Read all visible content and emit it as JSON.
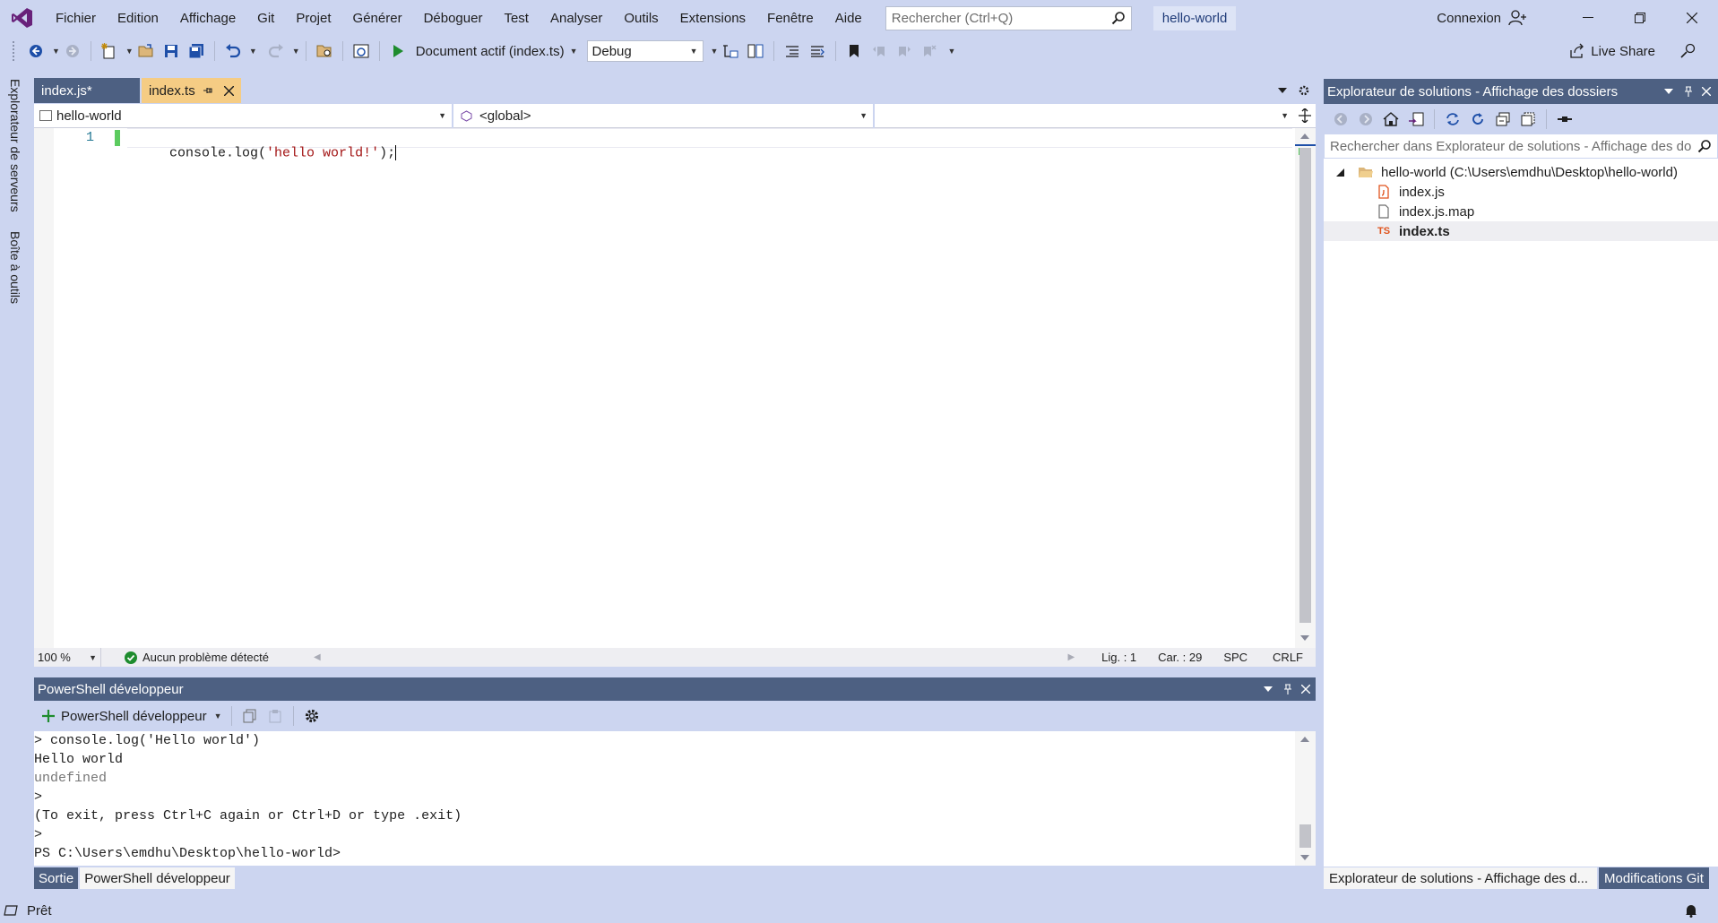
{
  "titlebar": {
    "menu": [
      "Fichier",
      "Edition",
      "Affichage",
      "Git",
      "Projet",
      "Générer",
      "Déboguer",
      "Test",
      "Analyser",
      "Outils",
      "Extensions",
      "Fenêtre",
      "Aide"
    ],
    "search_placeholder": "Rechercher (Ctrl+Q)",
    "solution_name": "hello-world",
    "signin": "Connexion"
  },
  "toolbar": {
    "run_label": "Document actif (index.ts)",
    "config": "Debug",
    "live_share": "Live Share"
  },
  "left_rail": {
    "server_explorer": "Explorateur de serveurs",
    "toolbox": "Boîte à outils"
  },
  "editor": {
    "tabs": [
      {
        "label": "index.js*",
        "active": false
      },
      {
        "label": "index.ts",
        "active": true
      }
    ],
    "nav_project": "hello-world",
    "nav_scope": "<global>",
    "line_number": "1",
    "code_prefix": "console.log(",
    "code_string": "'hello world!'",
    "code_suffix": ");",
    "status": {
      "zoom": "100 %",
      "problems": "Aucun problème détecté",
      "line": "Lig. : 1",
      "col": "Car. : 29",
      "indent": "SPC",
      "eol": "CRLF"
    }
  },
  "terminal": {
    "title": "PowerShell développeur",
    "new_terminal_label": "PowerShell développeur",
    "lines": [
      {
        "text": "> console.log('Hello world')",
        "dim": false
      },
      {
        "text": "Hello world",
        "dim": false
      },
      {
        "text": "undefined",
        "dim": true
      },
      {
        "text": ">",
        "dim": false
      },
      {
        "text": "(To exit, press Ctrl+C again or Ctrl+D or type .exit)",
        "dim": false
      },
      {
        "text": ">",
        "dim": false
      },
      {
        "text": "PS C:\\Users\\emdhu\\Desktop\\hello-world>",
        "dim": false
      }
    ],
    "bottom_tabs": [
      "Sortie",
      "PowerShell développeur"
    ]
  },
  "solution_explorer": {
    "title": "Explorateur de solutions - Affichage des dossiers",
    "search_placeholder": "Rechercher dans Explorateur de solutions - Affichage des do",
    "root": "hello-world (C:\\Users\\emdhu\\Desktop\\hello-world)",
    "files": [
      {
        "name": "index.js",
        "icon": "js-file-icon",
        "selected": false
      },
      {
        "name": "index.js.map",
        "icon": "file-icon",
        "selected": false
      },
      {
        "name": "index.ts",
        "icon": "ts-file-icon",
        "selected": true
      }
    ],
    "bottom_tabs": [
      "Explorateur de solutions - Affichage des d...",
      "Modifications Git"
    ]
  },
  "statusbar": {
    "ready": "Prêt"
  },
  "colors": {
    "chrome": "#CCD5F0",
    "header_active": "#4D6082",
    "tab_active": "#F5CC84",
    "vs_purple": "#68217A",
    "string_red": "#A31515",
    "play_green": "#1E8C2E"
  }
}
